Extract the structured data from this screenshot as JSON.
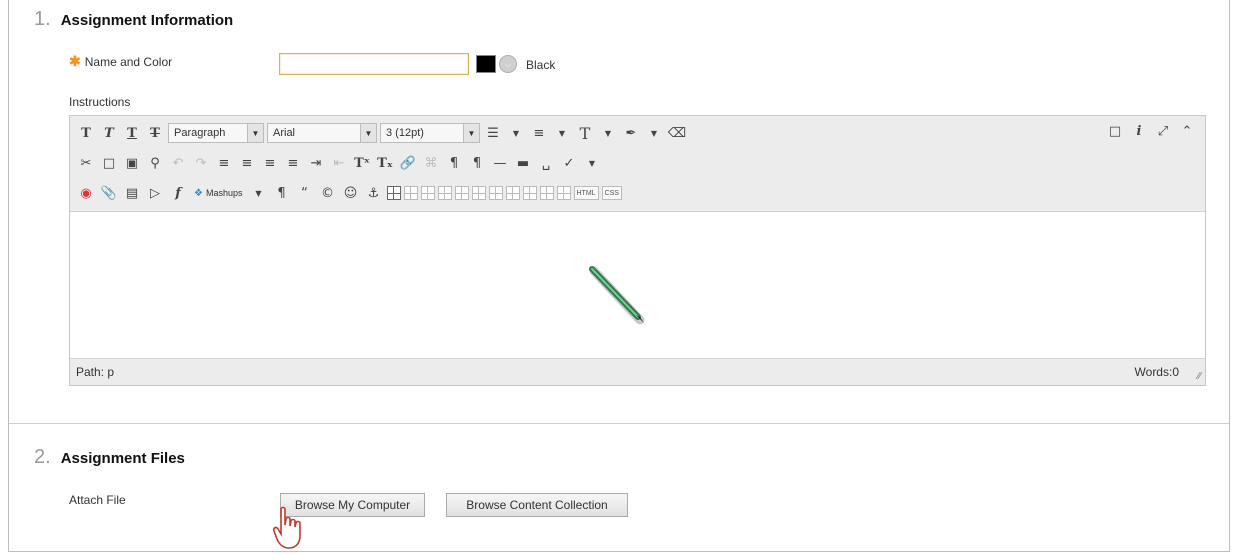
{
  "section1": {
    "number": "1.",
    "title": "Assignment Information"
  },
  "name_field": {
    "star": "✱",
    "label": "Name and Color",
    "value": "",
    "color_name": "Black",
    "color_hex": "#000000"
  },
  "instructions": {
    "label": "Instructions",
    "toolbar": {
      "format_select": "Paragraph",
      "font_select": "Arial",
      "size_select": "3 (12pt)",
      "mashups_label": "Mashups",
      "html_label": "HTML",
      "css_label": "CSS"
    },
    "path_label": "Path: p",
    "words_label": "Words:0"
  },
  "section2": {
    "number": "2.",
    "title": "Assignment Files"
  },
  "attach": {
    "label": "Attach File",
    "browse_computer": "Browse My Computer",
    "browse_collection": "Browse Content Collection"
  },
  "colors": {
    "required_star": "#f7941d",
    "input_border": "#d4b25a",
    "section_number": "#9a9a9a"
  }
}
